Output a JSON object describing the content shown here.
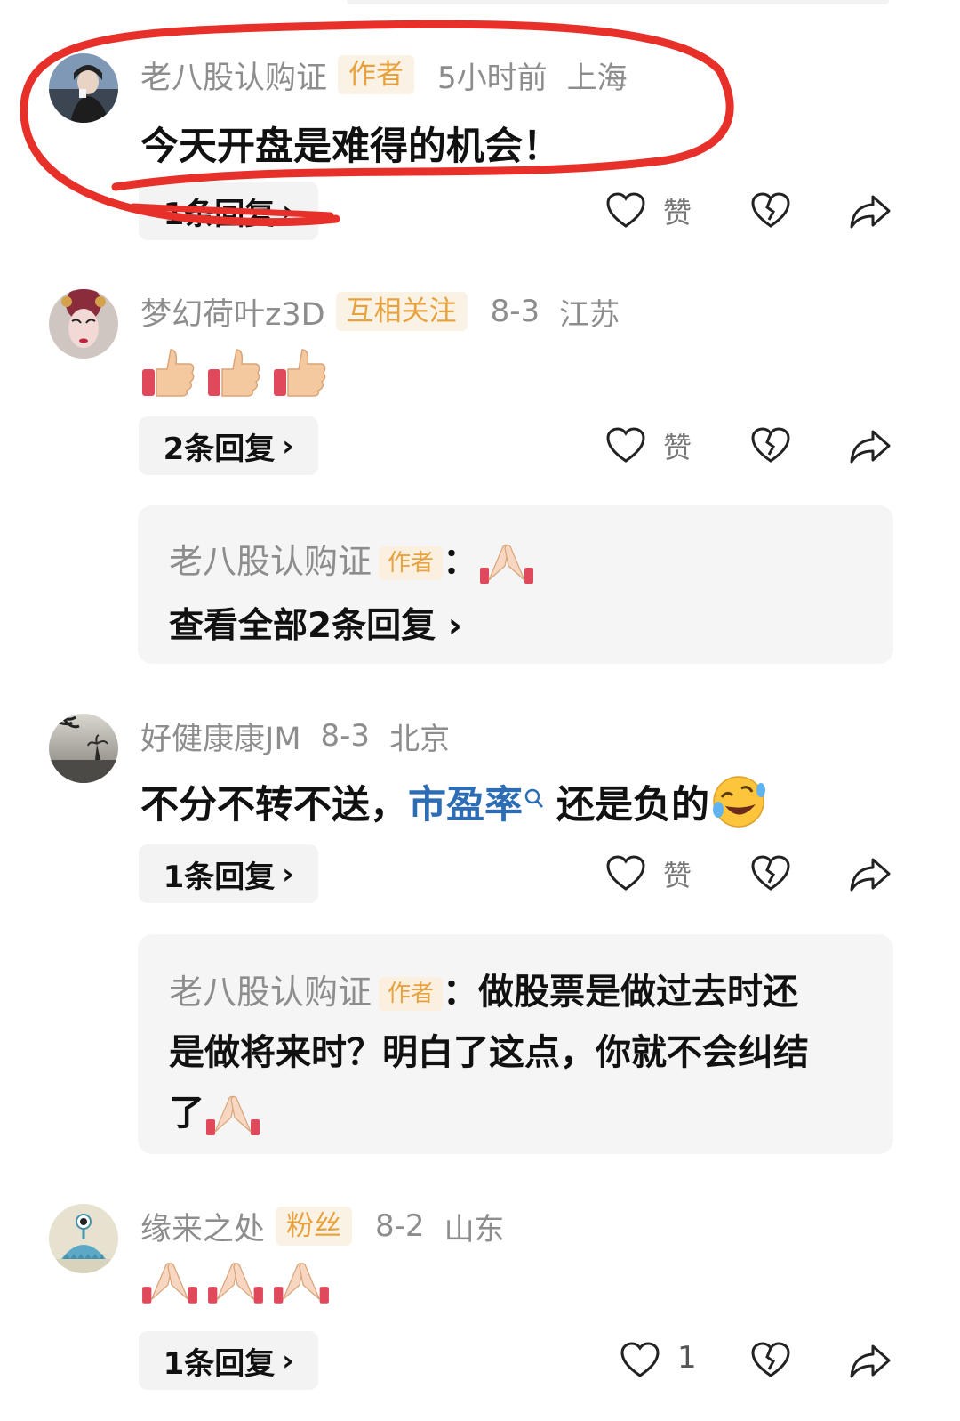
{
  "comments": [
    {
      "user": "老八股认购证",
      "badge": "作者",
      "time": "5小时前",
      "location": "上海",
      "text": "今天开盘是难得的机会！",
      "reply_label": "1条回复",
      "like_label": "赞"
    },
    {
      "user": "梦幻荷叶z3D",
      "badge": "互相关注",
      "time": "8-3",
      "location": "江苏",
      "emojis": [
        "thumbs-up",
        "thumbs-up",
        "thumbs-up"
      ],
      "reply_label": "2条回复",
      "like_label": "赞",
      "sub_reply": {
        "user": "老八股认购证",
        "badge": "作者",
        "sep": "：",
        "emoji": "praying-hands",
        "view_all": "查看全部2条回复"
      }
    },
    {
      "user": "好健康康JM",
      "time": "8-3",
      "location": "北京",
      "text_before": "不分不转不送，",
      "link": "市盈率",
      "text_after": "还是负的",
      "emoji": "rolling-laughing",
      "reply_label": "1条回复",
      "like_label": "赞",
      "sub_reply": {
        "user": "老八股认购证",
        "badge": "作者",
        "sep": "：",
        "lines": [
          "做股票是做过去时还",
          "是做将来时？明白了这点，你就不会纠结",
          "了"
        ],
        "emoji": "praying-hands"
      }
    },
    {
      "user": "缘来之处",
      "badge": "粉丝",
      "time": "8-2",
      "location": "山东",
      "emojis": [
        "praying-hands",
        "praying-hands",
        "praying-hands"
      ],
      "reply_label": "1条回复",
      "like_count": "1"
    }
  ],
  "chevron": "›",
  "colors": {
    "badge_bg": "#fbf2e6",
    "badge_text": "#e8a23d",
    "link": "#2c6db6",
    "annotation": "#e8302a"
  }
}
